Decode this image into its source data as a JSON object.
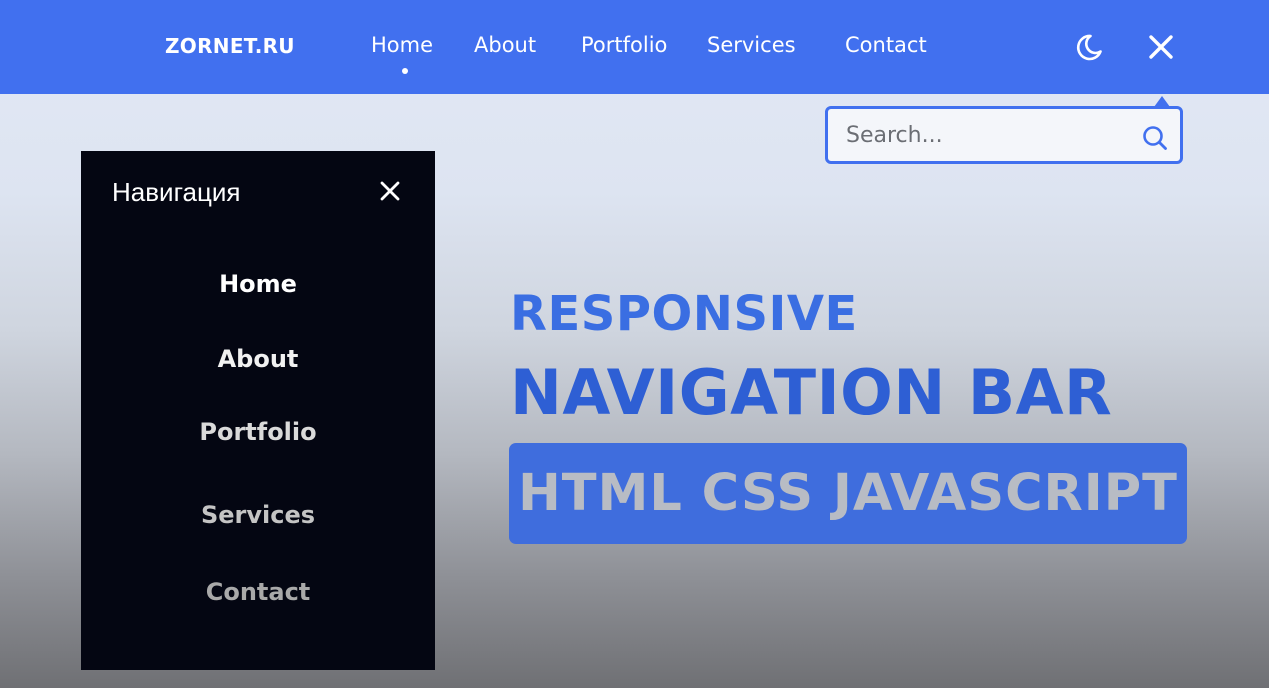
{
  "navbar": {
    "logo": "ZORNET.RU",
    "links": [
      "Home",
      "About",
      "Portfolio",
      "Services",
      "Contact"
    ],
    "active_link": "Home",
    "icons": [
      "moon-icon",
      "close-icon"
    ],
    "background_color": "#4170ef"
  },
  "search": {
    "placeholder": "Search...",
    "value": "",
    "icon": "search-icon",
    "border_color": "#4170ef"
  },
  "drawer": {
    "title": "Навигация",
    "close_icon": "close-icon",
    "links": [
      "Home",
      "About",
      "Portfolio",
      "Services",
      "Contact"
    ],
    "background_color": "#040612"
  },
  "hero": {
    "line1": "RESPONSIVE",
    "line2": "NAVIGATION BAR",
    "badge": "HTML CSS JAVASCRIPT",
    "accent_color": "#3a6ee2"
  }
}
